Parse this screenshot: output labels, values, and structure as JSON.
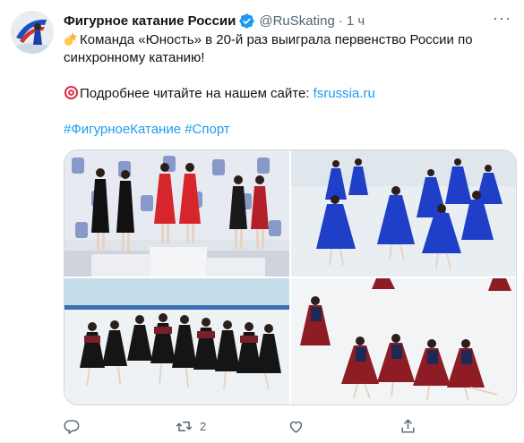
{
  "tweet": {
    "author_name": "Фигурное катание России",
    "handle": "@RuSkating",
    "separator": "·",
    "time": "1 ч",
    "lines": [
      "Команда «Юность» в 20-й раз выиграла первенство России по",
      "синхронному катанию!"
    ],
    "more_text_prefix": "Подробнее читайте на нашем сайте: ",
    "link": "fsrussia.ru",
    "hashtags": [
      "#ФигурноеКатание",
      "#Спорт"
    ]
  },
  "media": {
    "images": [
      {
        "name": "podium-photo"
      },
      {
        "name": "blue-dresses-photo"
      },
      {
        "name": "black-dresses-photo"
      },
      {
        "name": "red-dresses-photo"
      }
    ]
  },
  "actions": {
    "reply_count": "",
    "retweet_count": "2",
    "like_count": "",
    "share_count": ""
  },
  "icons": {
    "verified": "verified-badge-icon",
    "more": "more-options-icon",
    "reply": "reply-icon",
    "retweet": "retweet-icon",
    "like": "like-icon",
    "share": "share-icon"
  },
  "colors": {
    "accent": "#1d9bf0",
    "secondary_text": "#536471"
  }
}
